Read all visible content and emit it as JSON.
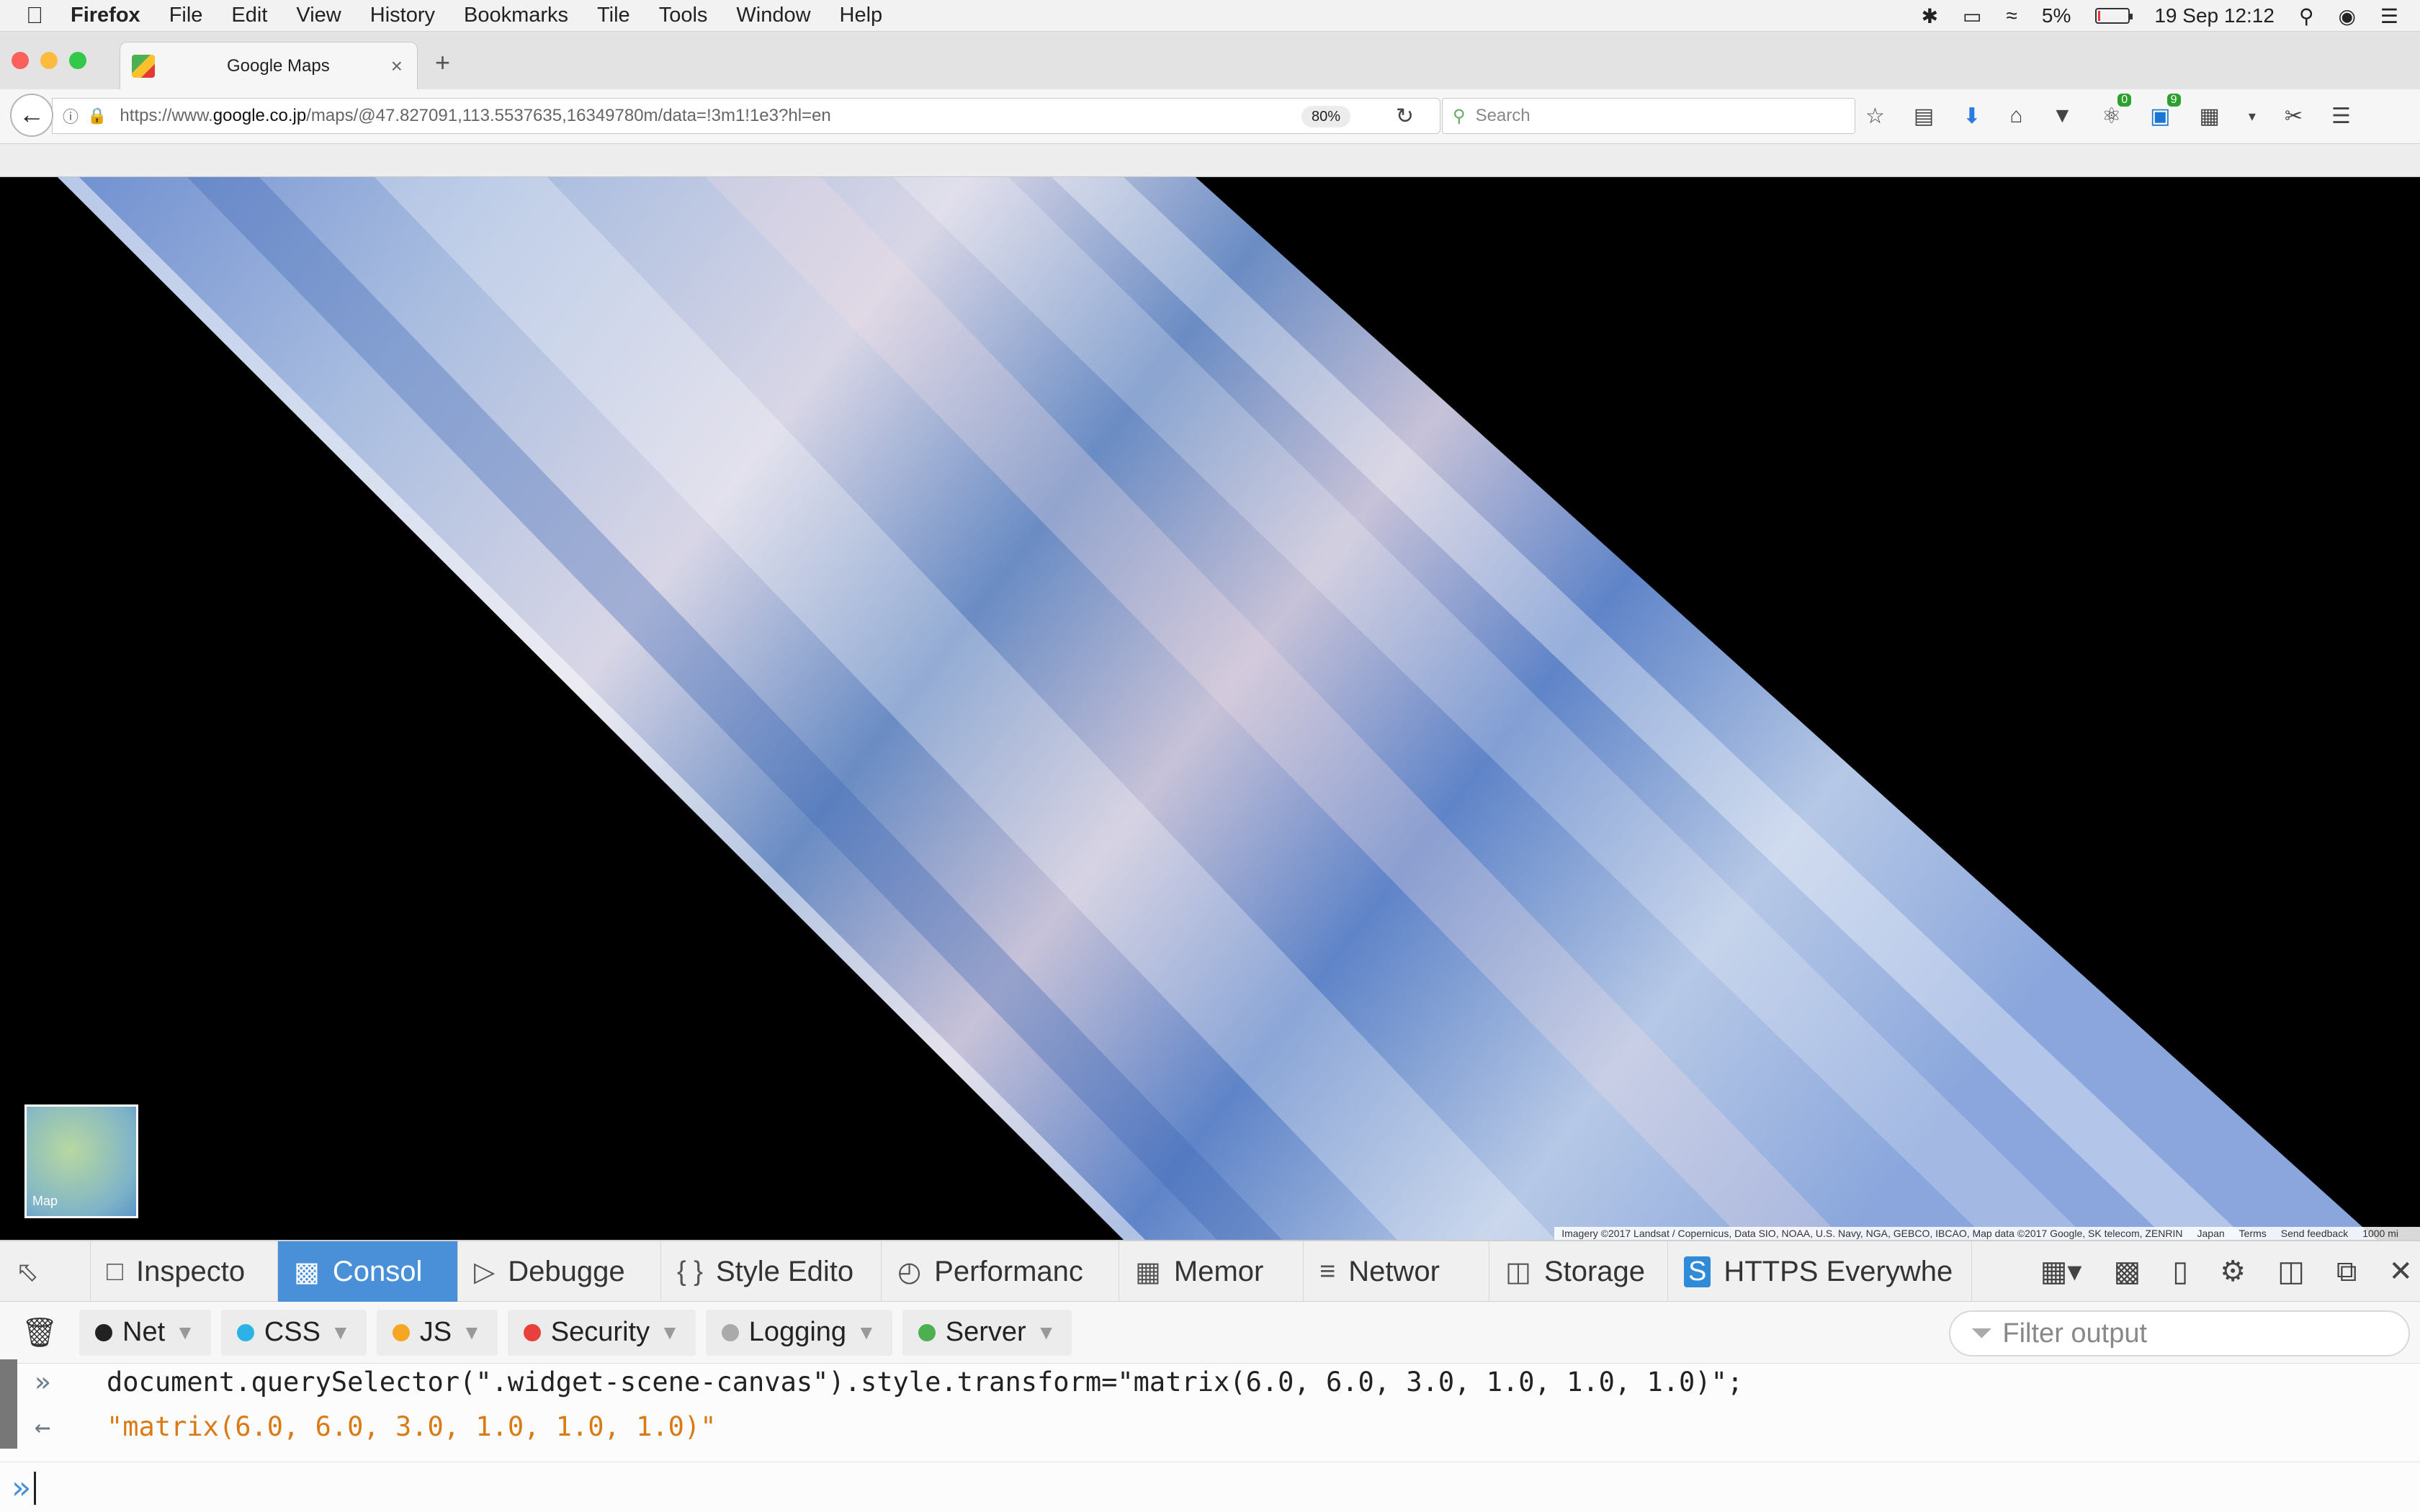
{
  "menubar": {
    "app_name": "Firefox",
    "menus": [
      "File",
      "Edit",
      "View",
      "History",
      "Bookmarks",
      "Tile",
      "Tools",
      "Window",
      "Help"
    ],
    "battery_percent": "5%",
    "battery_level": 0.05,
    "datetime": "19 Sep  12:12"
  },
  "tab": {
    "title": "Google Maps"
  },
  "navbar": {
    "url_prefix": "https://www.",
    "url_domain": "google.co.jp",
    "url_path": "/maps/@47.827091,113.5537635,16349780m/data=!3m1!1e3?hl=en",
    "zoom": "80%",
    "search_placeholder": "Search",
    "badge_1": "0",
    "badge_2": "9"
  },
  "map": {
    "minimap_label": "Map",
    "attribution": "Imagery ©2017 Landsat / Copernicus, Data SIO, NOAA, U.S. Navy, NGA, GEBCO, IBCAO, Map data ©2017 Google, SK telecom, ZENRIN",
    "region": "Japan",
    "terms": "Terms",
    "feedback": "Send feedback",
    "scale": "1000 mi"
  },
  "devtools": {
    "tabs": [
      {
        "label": "Inspecto"
      },
      {
        "label": "Consol"
      },
      {
        "label": "Debugge"
      },
      {
        "label": "Style Edito"
      },
      {
        "label": "Performanc"
      },
      {
        "label": "Memor"
      },
      {
        "label": "Networ"
      },
      {
        "label": "Storage"
      },
      {
        "label": "HTTPS Everywhe"
      }
    ],
    "filters": [
      {
        "label": "Net",
        "color": "#222222"
      },
      {
        "label": "CSS",
        "color": "#2bb3e8"
      },
      {
        "label": "JS",
        "color": "#f5a623"
      },
      {
        "label": "Security",
        "color": "#e8413c"
      },
      {
        "label": "Logging",
        "color": "#aaaaaa"
      },
      {
        "label": "Server",
        "color": "#4caf50"
      }
    ],
    "filter_placeholder": "Filter output",
    "input_line": "document.querySelector(\".widget-scene-canvas\").style.transform=\"matrix(6.0, 6.0, 3.0, 1.0, 1.0, 1.0)\";",
    "output_line": "\"matrix(6.0, 6.0, 3.0, 1.0, 1.0, 1.0)\"",
    "output_color": "#d97a15"
  }
}
